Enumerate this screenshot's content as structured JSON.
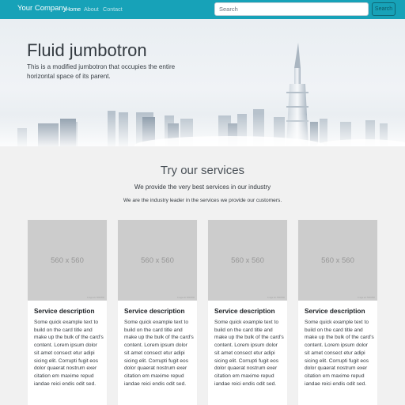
{
  "navbar": {
    "brand": "Your Company",
    "links": [
      {
        "label": "Home",
        "active": true
      },
      {
        "label": "About",
        "active": false
      },
      {
        "label": "Contact",
        "active": false
      }
    ],
    "search_placeholder": "Search",
    "search_button_label": "Search",
    "background_color": "#17a2b8"
  },
  "jumbotron": {
    "title": "Fluid jumbotron",
    "lead": "This is a modified jumbotron that occupies the entire horizontal space of its parent."
  },
  "services": {
    "title": "Try our services",
    "lead": "We provide the very best services in our industry",
    "text": "We are the industry leader in the services we provide our customers."
  },
  "cards": [
    {
      "image_label": "560 x 560",
      "image_credit": "image alt: 560x560",
      "title": "Service description",
      "text": "Some quick example text to build on the card title and make up the bulk of the card's content. Lorem ipsum dolor sit amet consect etur adipi sicing elit. Corrupti fugit eos dolor quaerat nostrum exer citation em maxime repud iandae reici endis odit sed."
    },
    {
      "image_label": "560 x 560",
      "image_credit": "image alt: 560x560",
      "title": "Service description",
      "text": "Some quick example text to build on the card title and make up the bulk of the card's content. Lorem ipsum dolor sit amet consect etur adipi sicing elit. Corrupti fugit eos dolor quaerat nostrum exer citation em maxime repud iandae reici endis odit sed."
    },
    {
      "image_label": "560 x 560",
      "image_credit": "image alt: 560x560",
      "title": "Service description",
      "text": "Some quick example text to build on the card title and make up the bulk of the card's content. Lorem ipsum dolor sit amet consect etur adipi sicing elit. Corrupti fugit eos dolor quaerat nostrum exer citation em maxime repud iandae reici endis odit sed."
    },
    {
      "image_label": "560 x 560",
      "image_credit": "image alt: 560x560",
      "title": "Service description",
      "text": "Some quick example text to build on the card title and make up the bulk of the card's content. Lorem ipsum dolor sit amet consect etur adipi sicing elit. Corrupti fugit eos dolor quaerat nostrum exer citation em maxime repud iandae reici endis odit sed."
    }
  ]
}
